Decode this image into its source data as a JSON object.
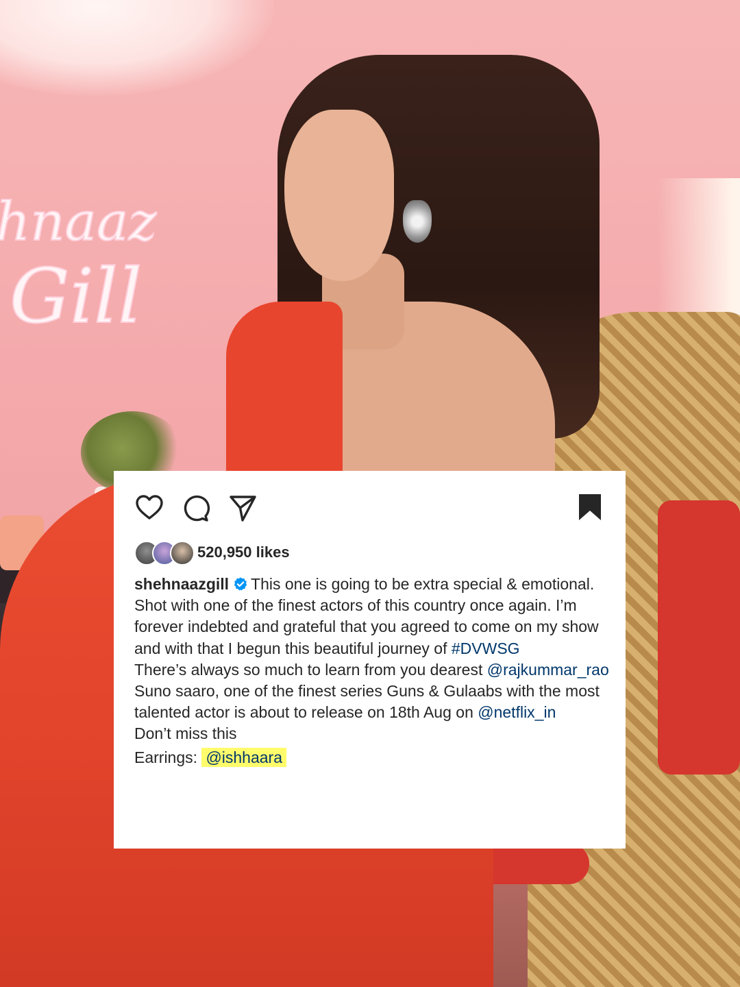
{
  "background": {
    "description_icon": "photo-background",
    "neon_sign_lines": [
      "hnaaz",
      "Gill"
    ]
  },
  "post": {
    "actions": {
      "like_icon": "heart-icon",
      "comment_icon": "comment-icon",
      "share_icon": "send-icon",
      "save_icon": "bookmark-icon"
    },
    "likes_text": "520,950 likes",
    "username": "shehnaazgill",
    "caption": {
      "line1": "This one is going to be extra special & emotional. Shot with one of the finest actors of this country once again. I’m forever indebted and grateful that you agreed to come on my show and with that I begun this beautiful journey of ",
      "hashtag": "#DVWSG",
      "line2": "There’s always so much to learn from you dearest ",
      "mention1": "@rajkummar_rao",
      "line3": "Suno saaro, one of the finest series Guns & Gulaabs with the most talented actor is about to release on 18th Aug on ",
      "mention2": "@netflix_in",
      "line4": "Don’t miss this",
      "earrings_label": "Earrings: ",
      "mention3": "@ishhaara"
    },
    "colors": {
      "link": "#00376b",
      "verified": "#0095f6",
      "highlight": "#fffc6b"
    }
  }
}
